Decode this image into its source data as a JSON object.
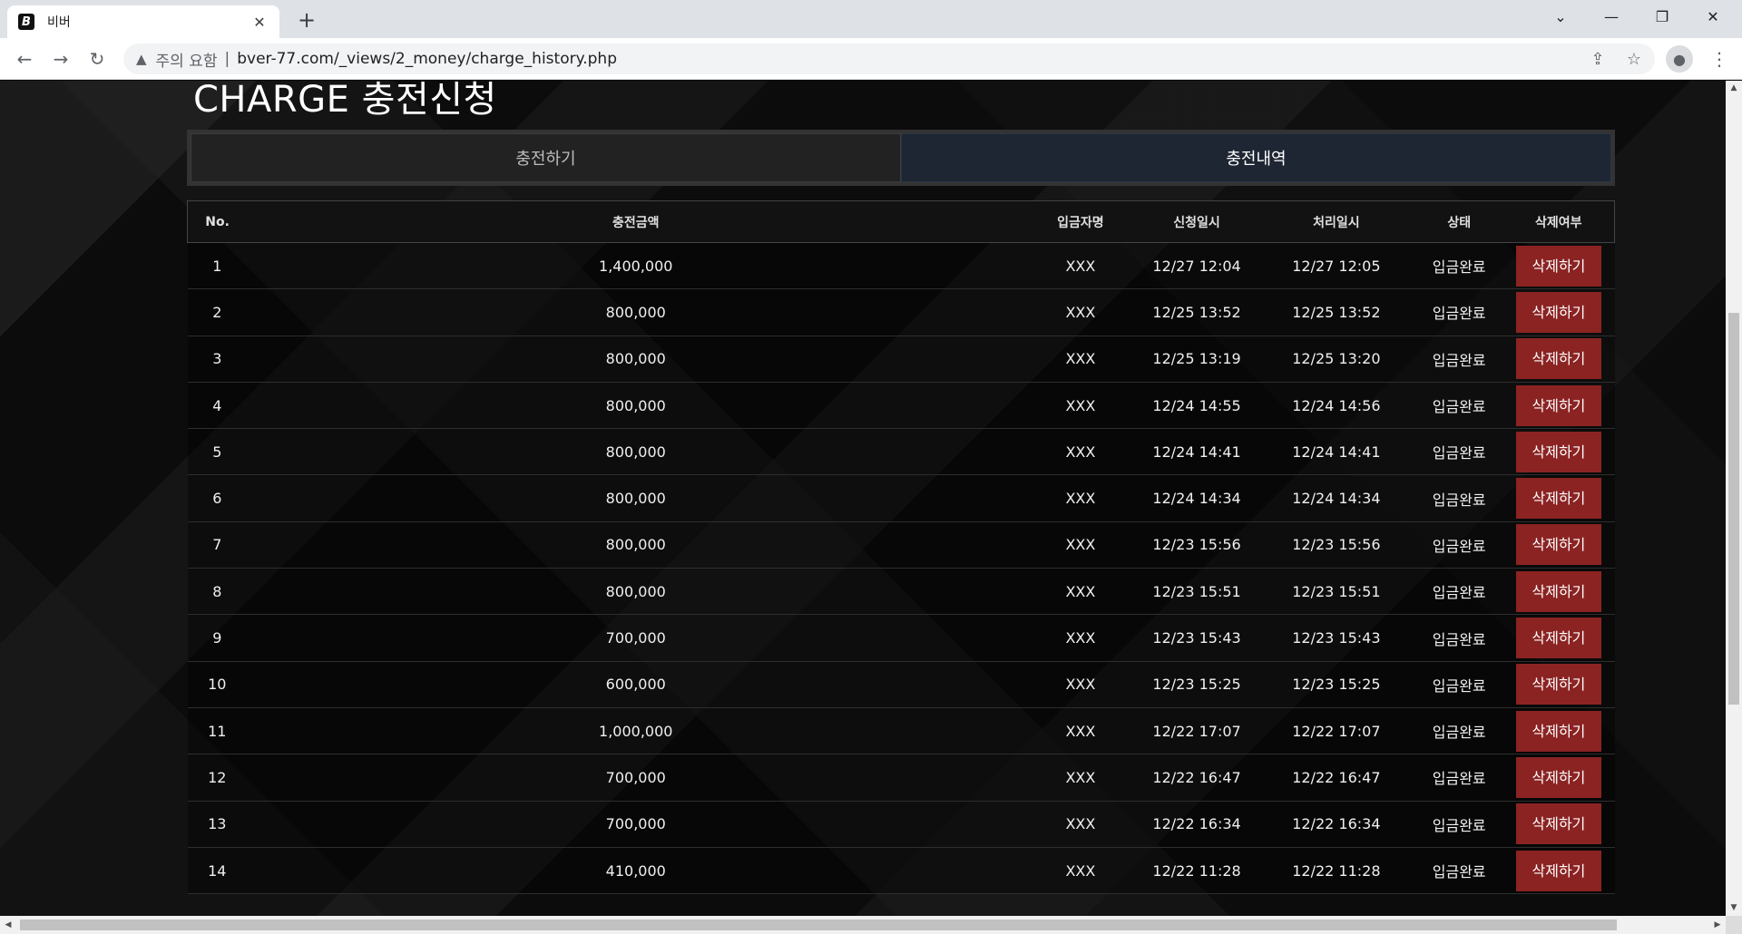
{
  "browser": {
    "tab_title": "비버",
    "favicon_letter": "B",
    "security_label": "주의 요함",
    "url": "bver-77.com/_views/2_money/charge_history.php"
  },
  "page": {
    "title": "CHARGE 충전신청",
    "tabs": [
      {
        "label": "충전하기",
        "active": false
      },
      {
        "label": "충전내역",
        "active": true
      }
    ]
  },
  "table": {
    "headers": {
      "no": "No.",
      "amount": "충전금액",
      "depositor": "입금자명",
      "requested": "신청일시",
      "processed": "처리일시",
      "status": "상태",
      "delete": "삭제여부"
    },
    "rows": [
      {
        "no": "1",
        "amount": "1,400,000",
        "depositor": "XXX",
        "requested": "12/27 12:04",
        "processed": "12/27 12:05",
        "status": "입금완료",
        "action": "삭제하기"
      },
      {
        "no": "2",
        "amount": "800,000",
        "depositor": "XXX",
        "requested": "12/25 13:52",
        "processed": "12/25 13:52",
        "status": "입금완료",
        "action": "삭제하기"
      },
      {
        "no": "3",
        "amount": "800,000",
        "depositor": "XXX",
        "requested": "12/25 13:19",
        "processed": "12/25 13:20",
        "status": "입금완료",
        "action": "삭제하기"
      },
      {
        "no": "4",
        "amount": "800,000",
        "depositor": "XXX",
        "requested": "12/24 14:55",
        "processed": "12/24 14:56",
        "status": "입금완료",
        "action": "삭제하기"
      },
      {
        "no": "5",
        "amount": "800,000",
        "depositor": "XXX",
        "requested": "12/24 14:41",
        "processed": "12/24 14:41",
        "status": "입금완료",
        "action": "삭제하기"
      },
      {
        "no": "6",
        "amount": "800,000",
        "depositor": "XXX",
        "requested": "12/24 14:34",
        "processed": "12/24 14:34",
        "status": "입금완료",
        "action": "삭제하기"
      },
      {
        "no": "7",
        "amount": "800,000",
        "depositor": "XXX",
        "requested": "12/23 15:56",
        "processed": "12/23 15:56",
        "status": "입금완료",
        "action": "삭제하기"
      },
      {
        "no": "8",
        "amount": "800,000",
        "depositor": "XXX",
        "requested": "12/23 15:51",
        "processed": "12/23 15:51",
        "status": "입금완료",
        "action": "삭제하기"
      },
      {
        "no": "9",
        "amount": "700,000",
        "depositor": "XXX",
        "requested": "12/23 15:43",
        "processed": "12/23 15:43",
        "status": "입금완료",
        "action": "삭제하기"
      },
      {
        "no": "10",
        "amount": "600,000",
        "depositor": "XXX",
        "requested": "12/23 15:25",
        "processed": "12/23 15:25",
        "status": "입금완료",
        "action": "삭제하기"
      },
      {
        "no": "11",
        "amount": "1,000,000",
        "depositor": "XXX",
        "requested": "12/22 17:07",
        "processed": "12/22 17:07",
        "status": "입금완료",
        "action": "삭제하기"
      },
      {
        "no": "12",
        "amount": "700,000",
        "depositor": "XXX",
        "requested": "12/22 16:47",
        "processed": "12/22 16:47",
        "status": "입금완료",
        "action": "삭제하기"
      },
      {
        "no": "13",
        "amount": "700,000",
        "depositor": "XXX",
        "requested": "12/22 16:34",
        "processed": "12/22 16:34",
        "status": "입금완료",
        "action": "삭제하기"
      },
      {
        "no": "14",
        "amount": "410,000",
        "depositor": "XXX",
        "requested": "12/22 11:28",
        "processed": "12/22 11:28",
        "status": "입금완료",
        "action": "삭제하기"
      }
    ]
  },
  "colors": {
    "delete_button": "#8b2323",
    "active_tab": "#1e2633"
  }
}
